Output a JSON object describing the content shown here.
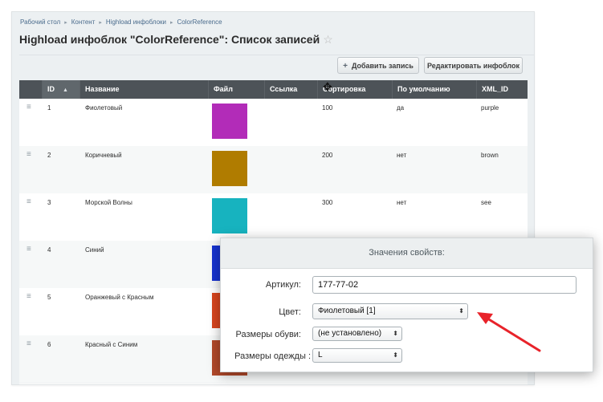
{
  "breadcrumbs": [
    "Рабочий стол",
    "Контент",
    "Highload инфоблоки",
    "ColorReference"
  ],
  "breadcrumb_sep": "▸",
  "page_title": "Highload инфоблок \"ColorReference\": Список записей",
  "favorite_icon": "☆",
  "toolbar": {
    "add_label": "Добавить запись",
    "add_icon": "+",
    "edit_label": "Редактировать инфоблок"
  },
  "grid": {
    "columns": [
      "ID",
      "Название",
      "Файл",
      "Ссылка",
      "Сортировка",
      "По умолчанию",
      "XML_ID"
    ],
    "sorted_column": "ID",
    "sort_direction_icon": "▲",
    "rows": [
      {
        "id": "1",
        "name": "Фиолетовый",
        "color": "#b22cb8",
        "sort": "100",
        "default": "да",
        "xml_id": "purple"
      },
      {
        "id": "2",
        "name": "Коричневый",
        "color": "#b07c00",
        "sort": "200",
        "default": "нет",
        "xml_id": "brown"
      },
      {
        "id": "3",
        "name": "Морской Волны",
        "color": "#17b3bf",
        "sort": "300",
        "default": "нет",
        "xml_id": "see"
      },
      {
        "id": "4",
        "name": "Синий",
        "color": "#1733d0",
        "sort": "",
        "default": "",
        "xml_id": ""
      },
      {
        "id": "5",
        "name": "Оранжевый с Красным",
        "color": "#d8451e",
        "sort": "",
        "default": "",
        "xml_id": ""
      },
      {
        "id": "6",
        "name": "Красный с Синим",
        "color": "#b2492a",
        "sort": "",
        "default": "",
        "xml_id": ""
      }
    ]
  },
  "dialog": {
    "title": "Значения свойств:",
    "article_label": "Артикул:",
    "article_value": "177-77-02",
    "color_label": "Цвет:",
    "color_value": "Фиолетовый [1]",
    "shoe_label": "Размеры обуви:",
    "shoe_value": "(не установлено)",
    "clothes_label": "Размеры одежды :",
    "clothes_value": "L",
    "annotation_color": "#e8232a"
  }
}
